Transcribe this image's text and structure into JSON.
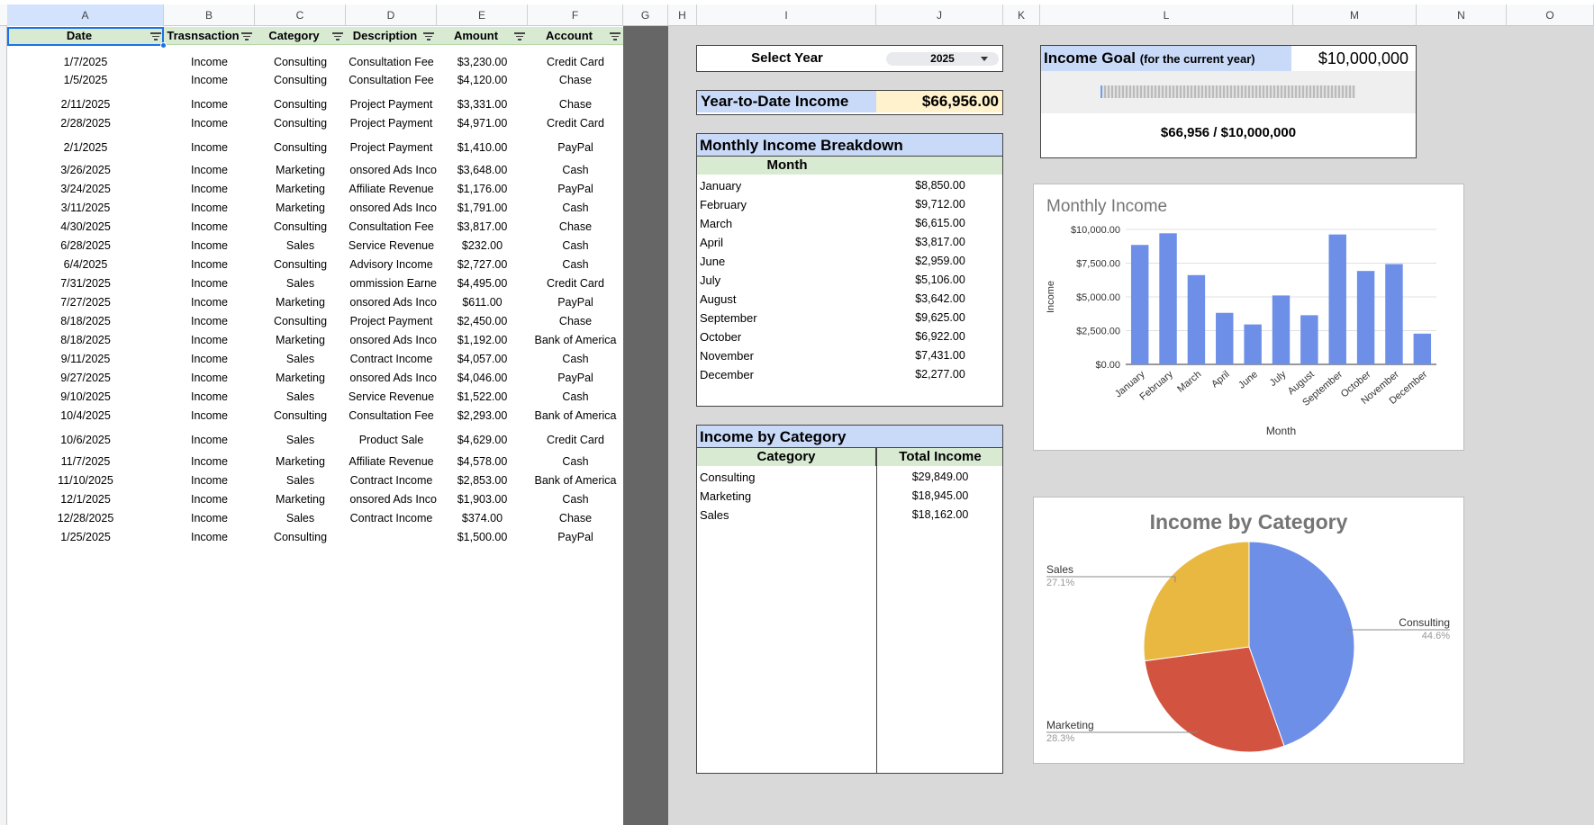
{
  "columns": [
    "A",
    "B",
    "C",
    "D",
    "E",
    "F",
    "G",
    "H",
    "I",
    "J",
    "K",
    "L",
    "M",
    "N",
    "O"
  ],
  "table": {
    "headers": [
      "Date",
      "Trasnsaction",
      "Category",
      "Description",
      "Amount",
      "Account"
    ],
    "rows": [
      [
        "1/7/2025",
        "Income",
        "Consulting",
        "Consultation Fee",
        "$3,230.00",
        "Credit Card"
      ],
      [
        "1/5/2025",
        "Income",
        "Consulting",
        "Consultation Fee",
        "$4,120.00",
        "Chase"
      ],
      [
        "2/11/2025",
        "Income",
        "Consulting",
        "Project Payment",
        "$3,331.00",
        "Chase"
      ],
      [
        "2/28/2025",
        "Income",
        "Consulting",
        "Project Payment",
        "$4,971.00",
        "Credit Card"
      ],
      [
        "2/1/2025",
        "Income",
        "Consulting",
        "Project Payment",
        "$1,410.00",
        "PayPal"
      ],
      [
        "3/26/2025",
        "Income",
        "Marketing",
        "onsored Ads Inco",
        "$3,648.00",
        "Cash"
      ],
      [
        "3/24/2025",
        "Income",
        "Marketing",
        "Affiliate Revenue",
        "$1,176.00",
        "PayPal"
      ],
      [
        "3/11/2025",
        "Income",
        "Marketing",
        "onsored Ads Inco",
        "$1,791.00",
        "Cash"
      ],
      [
        "4/30/2025",
        "Income",
        "Consulting",
        "Consultation Fee",
        "$3,817.00",
        "Chase"
      ],
      [
        "6/28/2025",
        "Income",
        "Sales",
        "Service Revenue",
        "$232.00",
        "Cash"
      ],
      [
        "6/4/2025",
        "Income",
        "Consulting",
        "Advisory Income",
        "$2,727.00",
        "Cash"
      ],
      [
        "7/31/2025",
        "Income",
        "Sales",
        "ommission Earne",
        "$4,495.00",
        "Credit Card"
      ],
      [
        "7/27/2025",
        "Income",
        "Marketing",
        "onsored Ads Inco",
        "$611.00",
        "PayPal"
      ],
      [
        "8/18/2025",
        "Income",
        "Consulting",
        "Project Payment",
        "$2,450.00",
        "Chase"
      ],
      [
        "8/18/2025",
        "Income",
        "Marketing",
        "onsored Ads Inco",
        "$1,192.00",
        "Bank of America"
      ],
      [
        "9/11/2025",
        "Income",
        "Sales",
        "Contract Income",
        "$4,057.00",
        "Cash"
      ],
      [
        "9/27/2025",
        "Income",
        "Marketing",
        "onsored Ads Inco",
        "$4,046.00",
        "PayPal"
      ],
      [
        "9/10/2025",
        "Income",
        "Sales",
        "Service Revenue",
        "$1,522.00",
        "Cash"
      ],
      [
        "10/4/2025",
        "Income",
        "Consulting",
        "Consultation Fee",
        "$2,293.00",
        "Bank of America"
      ],
      [
        "10/6/2025",
        "Income",
        "Sales",
        "Product Sale",
        "$4,629.00",
        "Credit Card"
      ],
      [
        "11/7/2025",
        "Income",
        "Marketing",
        "Affiliate Revenue",
        "$4,578.00",
        "Cash"
      ],
      [
        "11/10/2025",
        "Income",
        "Sales",
        "Contract Income",
        "$2,853.00",
        "Bank of America"
      ],
      [
        "12/1/2025",
        "Income",
        "Marketing",
        "onsored Ads Inco",
        "$1,903.00",
        "Cash"
      ],
      [
        "12/28/2025",
        "Income",
        "Sales",
        "Contract Income",
        "$374.00",
        "Chase"
      ],
      [
        "1/25/2025",
        "Income",
        "Consulting",
        "",
        "$1,500.00",
        "PayPal"
      ]
    ]
  },
  "select_year": {
    "label": "Select Year",
    "value": "2025"
  },
  "ytd": {
    "label": "Year-to-Date Income",
    "value": "$66,956.00"
  },
  "monthly_breakdown": {
    "title": "Monthly Income Breakdown",
    "header": "Month",
    "rows": [
      [
        "January",
        "$8,850.00"
      ],
      [
        "February",
        "$9,712.00"
      ],
      [
        "March",
        "$6,615.00"
      ],
      [
        "April",
        "$3,817.00"
      ],
      [
        "June",
        "$2,959.00"
      ],
      [
        "July",
        "$5,106.00"
      ],
      [
        "August",
        "$3,642.00"
      ],
      [
        "September",
        "$9,625.00"
      ],
      [
        "October",
        "$6,922.00"
      ],
      [
        "November",
        "$7,431.00"
      ],
      [
        "December",
        "$2,277.00"
      ]
    ]
  },
  "income_by_category": {
    "title": "Income by Category",
    "headers": [
      "Category",
      "Total Income"
    ],
    "rows": [
      [
        "Consulting",
        "$29,849.00"
      ],
      [
        "Marketing",
        "$18,945.00"
      ],
      [
        "Sales",
        "$18,162.00"
      ]
    ]
  },
  "income_goal": {
    "label": "Income Goal",
    "note": "(for the current year)",
    "value": "$10,000,000",
    "progress_text": "$66,956 / $10,000,000",
    "progress_fraction": 0.0067
  },
  "colors": {
    "blue": "#6d8fe8",
    "red": "#d2533f",
    "yellow": "#e9b840",
    "header_green": "#d9ead3",
    "header_blue": "#c9daf8"
  },
  "chart_data": [
    {
      "type": "bar",
      "title": "Monthly Income",
      "xlabel": "Month",
      "ylabel": "Income",
      "ylim": [
        0,
        10000
      ],
      "yticks": [
        "$0.00",
        "$2,500.00",
        "$5,000.00",
        "$7,500.00",
        "$10,000.00"
      ],
      "categories": [
        "January",
        "February",
        "March",
        "April",
        "June",
        "July",
        "August",
        "September",
        "October",
        "November",
        "December"
      ],
      "values": [
        8850,
        9712,
        6615,
        3817,
        2959,
        5106,
        3642,
        9625,
        6922,
        7431,
        2277
      ],
      "grid": true
    },
    {
      "type": "pie",
      "title": "Income by Category",
      "labels": [
        "Consulting",
        "Marketing",
        "Sales"
      ],
      "values": [
        29849,
        18945,
        18162
      ],
      "percents": [
        "44.6%",
        "28.3%",
        "27.1%"
      ]
    }
  ]
}
